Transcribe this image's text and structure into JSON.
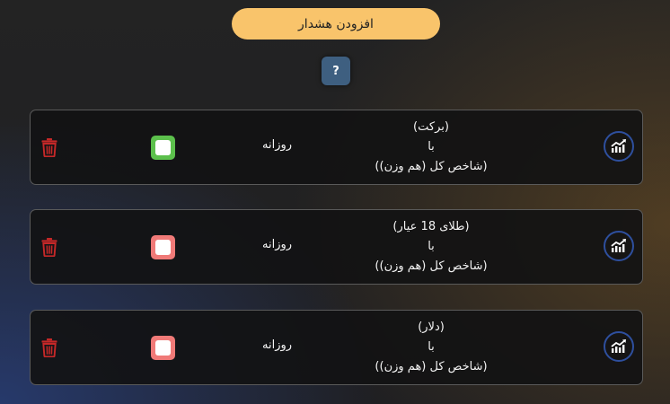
{
  "header": {
    "add_alert_label": "افزودن هشدار",
    "help_label": "?"
  },
  "colors": {
    "add_button": "#f9c46b",
    "help_button": "#3e5f80",
    "active_status": "#5cc04c",
    "inactive_status": "#f07a78",
    "delete_icon": "#c62828",
    "chart_ring": "#2e4f9e"
  },
  "alerts": [
    {
      "symbol": "(برکت)",
      "connector": "با",
      "index": "(شاخص کل (هم وزن))",
      "frequency": "روزانه",
      "status": "active",
      "status_icon": "green-check-box",
      "chart_icon": "trending-chart-icon",
      "delete_icon": "trash-icon"
    },
    {
      "symbol": "(طلای 18 عیار)",
      "connector": "با",
      "index": "(شاخص کل (هم وزن))",
      "frequency": "روزانه",
      "status": "inactive",
      "status_icon": "red-box",
      "chart_icon": "trending-chart-icon",
      "delete_icon": "trash-icon"
    },
    {
      "symbol": "(دلار)",
      "connector": "با",
      "index": "(شاخص کل (هم وزن))",
      "frequency": "روزانه",
      "status": "inactive",
      "status_icon": "red-box",
      "chart_icon": "trending-chart-icon",
      "delete_icon": "trash-icon"
    }
  ]
}
